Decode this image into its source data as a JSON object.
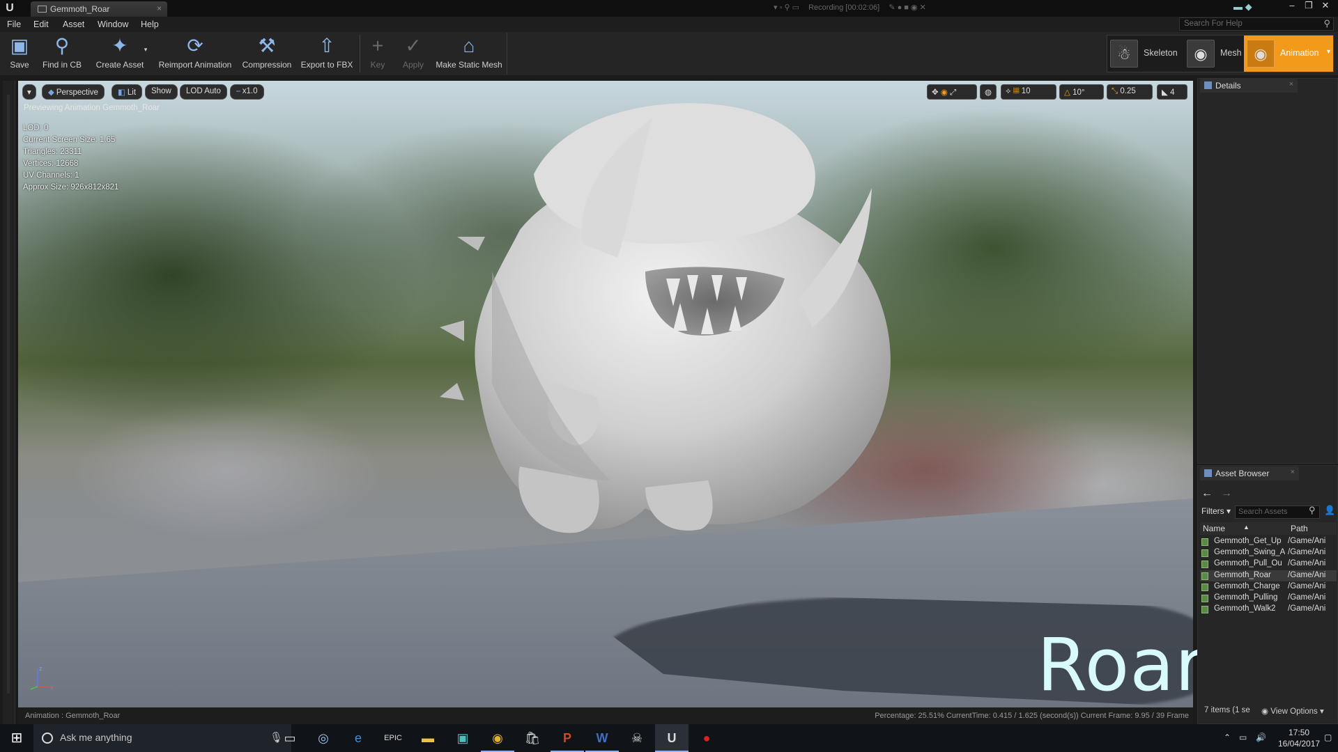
{
  "window": {
    "tab_title": "Gemmoth_Roar",
    "recording": "Recording [00:02:06]",
    "controls": [
      "–",
      "❐",
      "✕"
    ]
  },
  "menu": [
    "File",
    "Edit",
    "Asset",
    "Window",
    "Help"
  ],
  "help_search_placeholder": "Search For Help",
  "toolbar": {
    "save": "Save",
    "find_in_cb": "Find in CB",
    "create_asset": "Create Asset",
    "reimport": "Reimport Animation",
    "compression": "Compression",
    "export_fbx": "Export to FBX",
    "key": "Key",
    "apply": "Apply",
    "make_static_mesh": "Make Static Mesh"
  },
  "modes": {
    "skeleton": "Skeleton",
    "mesh": "Mesh",
    "animation": "Animation"
  },
  "viewport": {
    "perspective": "Perspective",
    "lit": "Lit",
    "show": "Show",
    "lod": "LOD Auto",
    "speed": "x1.0",
    "grid_snap": "10",
    "rot_snap": "10°",
    "scale_snap": "0.25",
    "camera_speed": "4",
    "preview_text": "Previewing Animation Gemmoth_Roar",
    "stats": [
      "LOD: 0",
      "Current Screen Size: 1.65",
      "Triangles: 23311",
      "Vertices: 12668",
      "UV Channels: 1",
      "Approx Size: 926x812x821"
    ],
    "overlay_caption": "Roar",
    "status_left": "Animation : Gemmoth_Roar",
    "status_right": "Percentage: 25.51% CurrentTime: 0.415 / 1.625 (second(s)) Current Frame: 9.95 / 39 Frame"
  },
  "details": {
    "tab": "Details"
  },
  "asset_browser": {
    "tab": "Asset Browser",
    "filters": "Filters",
    "search_placeholder": "Search Assets",
    "col_name": "Name",
    "col_path": "Path",
    "rows": [
      {
        "name": "Gemmoth_Get_Up",
        "path": "/Game/Ani"
      },
      {
        "name": "Gemmoth_Swing_A",
        "path": "/Game/Ani"
      },
      {
        "name": "Gemmoth_Pull_Ou",
        "path": "/Game/Ani"
      },
      {
        "name": "Gemmoth_Roar",
        "path": "/Game/Ani"
      },
      {
        "name": "Gemmoth_Charge",
        "path": "/Game/Ani"
      },
      {
        "name": "Gemmoth_Pulling",
        "path": "/Game/Ani"
      },
      {
        "name": "Gemmoth_Walk2",
        "path": "/Game/Ani"
      }
    ],
    "selected_row": 3,
    "count": "7 items (1 se",
    "view_options": "View Options"
  },
  "taskbar": {
    "search": "Ask me anything",
    "time": "17:50",
    "date": "16/04/2017"
  },
  "colors": {
    "accent": "#f39a1a",
    "caption": "#d8fafa"
  }
}
